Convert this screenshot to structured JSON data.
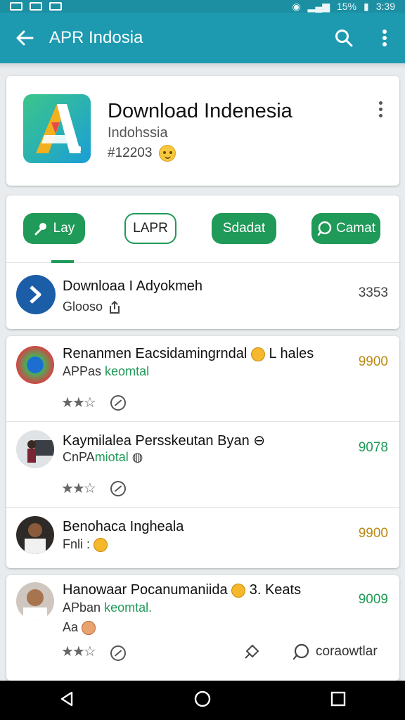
{
  "status_bar": {
    "battery": "15%",
    "time": "3:39"
  },
  "appbar": {
    "title": "APR Indosia"
  },
  "app": {
    "name": "Download Indenesia",
    "subtitle": "Indohssia",
    "id": "#12203"
  },
  "tabs": [
    {
      "label": "Lay",
      "icon": "pin-icon"
    },
    {
      "label": "LAPR",
      "icon": ""
    },
    {
      "label": "Sdadat",
      "icon": ""
    },
    {
      "label": "Camat",
      "icon": "chat-icon"
    }
  ],
  "download_row": {
    "title": "Downloaa I Adyokmeh",
    "sub": "Glooso",
    "value": "3353"
  },
  "items": [
    {
      "title": "Renanmen Eacsidamingrndal",
      "title_extra": "L hales",
      "sub_prefix": "APPas",
      "sub_green": "keomtal",
      "price": "9900"
    },
    {
      "title": "Kaymilalea Persskeutan Byan",
      "title_extra": "",
      "sub_prefix": "CnPA",
      "sub_green": "miotal",
      "price": "9078"
    },
    {
      "title": "Benohaca Ingheala",
      "title_extra": "",
      "sub_prefix": "Fnli :",
      "sub_green": "",
      "price": "9900"
    },
    {
      "title": "Hanowaar Pocanumaniida",
      "title_extra": "3. Keats",
      "sub_prefix": "APban",
      "sub_green": "keomtal.",
      "sub2": "Aa",
      "price": "9009",
      "comment_label": "coraowtlar"
    }
  ],
  "colors": {
    "appbar": "#1d9ab0",
    "accent_green": "#1f9a58",
    "price_gold": "#b98a13"
  }
}
